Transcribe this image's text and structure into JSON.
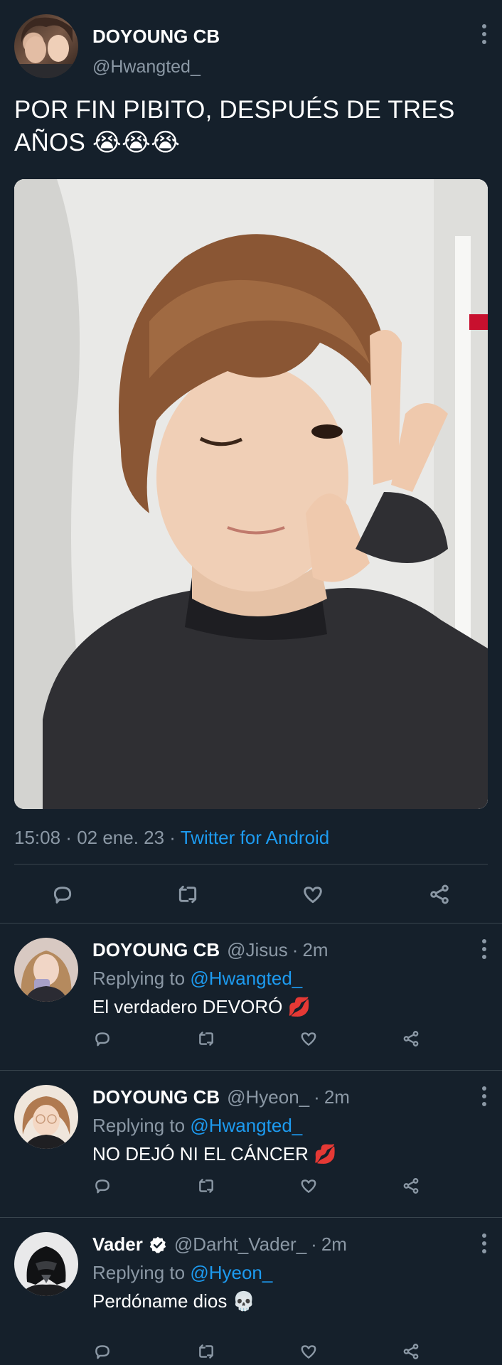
{
  "main_tweet": {
    "author_name": "DOYOUNG CB",
    "author_handle": "@Hwangted_",
    "text": "POR FIN PIBITO, DESPUÉS DE TRES AÑOS 😭😭😭",
    "time": "15:08",
    "date": "02 ene. 23",
    "client": "Twitter for Android",
    "separator": " · ",
    "actions": [
      "reply-icon",
      "retweet-icon",
      "like-icon",
      "share-icon"
    ]
  },
  "replies": [
    {
      "name": "DOYOUNG CB",
      "handle": "@Jisus",
      "time": "2m",
      "replying_prefix": "Replying to ",
      "replying_to": "@Hwangted_",
      "text": "El verdadero DEVORÓ 💋",
      "verified": false
    },
    {
      "name": "DOYOUNG CB",
      "handle": "@Hyeon_",
      "time": "2m",
      "replying_prefix": "Replying to ",
      "replying_to": "@Hwangted_",
      "text": "NO DEJÓ NI EL CÁNCER 💋",
      "verified": false
    },
    {
      "name": "Vader",
      "handle": "@Darht_Vader_",
      "time": "2m",
      "replying_prefix": "Replying to ",
      "replying_to": "@Hyeon_",
      "text": "Perdóname dios 💀",
      "verified": true
    }
  ],
  "colors": {
    "background": "#15202b",
    "link": "#1d9bf0",
    "muted": "#8b98a5",
    "divider": "#38444d"
  }
}
